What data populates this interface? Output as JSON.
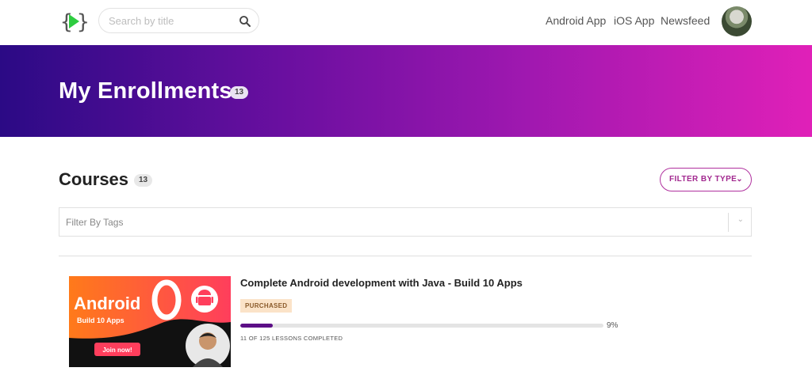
{
  "header": {
    "search_placeholder": "Search by title",
    "nav": [
      "Android App",
      "iOS App",
      "Newsfeed"
    ]
  },
  "banner": {
    "title": "My Enrollments",
    "count": "13"
  },
  "courses": {
    "title": "Courses",
    "count": "13",
    "filter_type_label": "FILTER BY TYPE",
    "tags_placeholder": "Filter By Tags"
  },
  "course": {
    "title": "Complete Android development with Java - Build 10 Apps",
    "badge": "PURCHASED",
    "progress_percent": 9,
    "progress_label": "9%",
    "lessons_completed": "11 OF 125 LESSONS COMPLETED",
    "thumbnail": {
      "headline": "Android",
      "subline": "Build 10 Apps",
      "cta": "Join now!"
    }
  },
  "colors": {
    "brand_purple": "#5c0f86",
    "accent_magenta": "#b0309e",
    "banner_start": "#2b0a85",
    "banner_end": "#e020b8"
  }
}
